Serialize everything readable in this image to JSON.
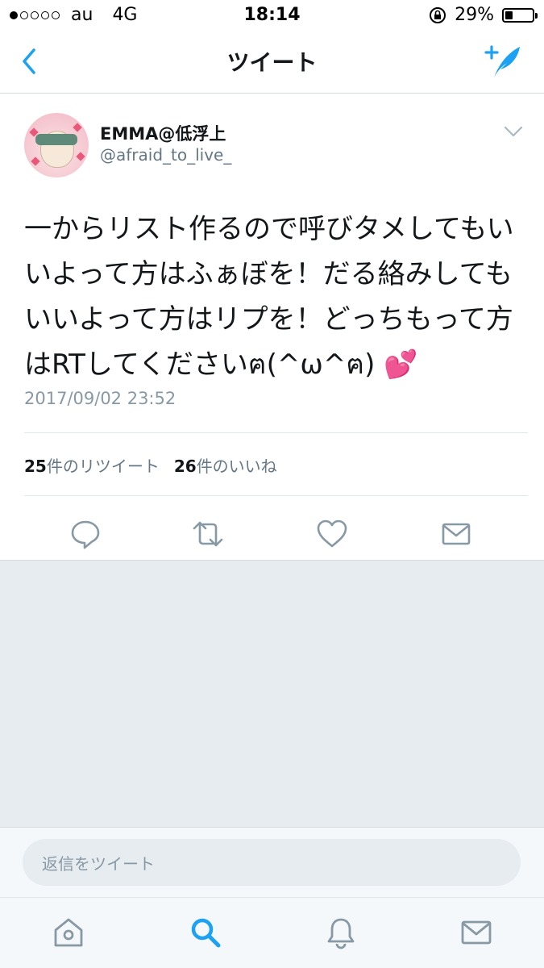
{
  "status_bar": {
    "carrier": "au",
    "network": "4G",
    "time": "18:14",
    "battery": "29%",
    "battery_level": 0.29,
    "signal_bars_filled": 1,
    "signal_bars_total": 5
  },
  "nav": {
    "title": "ツイート",
    "accent_color": "#1da1f2"
  },
  "tweet": {
    "display_name": "EMMA@低浮上",
    "handle": "@afraid_to_live_",
    "text": "一からリスト作るので呼びタメしてもいいよって方はふぁぼを！だる絡みしてもいいよって方はリプを！どっちもって方はRTしてくださいฅ(^ω^ฅ) ",
    "emoji": "💕",
    "timestamp": "2017/09/02 23:52",
    "retweet_count": "25",
    "retweet_label": "件のリツイート",
    "like_count": "26",
    "like_label": "件のいいね"
  },
  "reply": {
    "placeholder": "返信をツイート"
  },
  "icons": {
    "back": "chevron-left-icon",
    "compose": "compose-tweet-icon",
    "more": "chevron-down-icon",
    "reply": "reply-icon",
    "retweet": "retweet-icon",
    "like": "heart-icon",
    "dm": "envelope-icon",
    "home": "home-icon",
    "search": "search-icon",
    "notifications": "bell-icon",
    "messages": "envelope-icon"
  }
}
